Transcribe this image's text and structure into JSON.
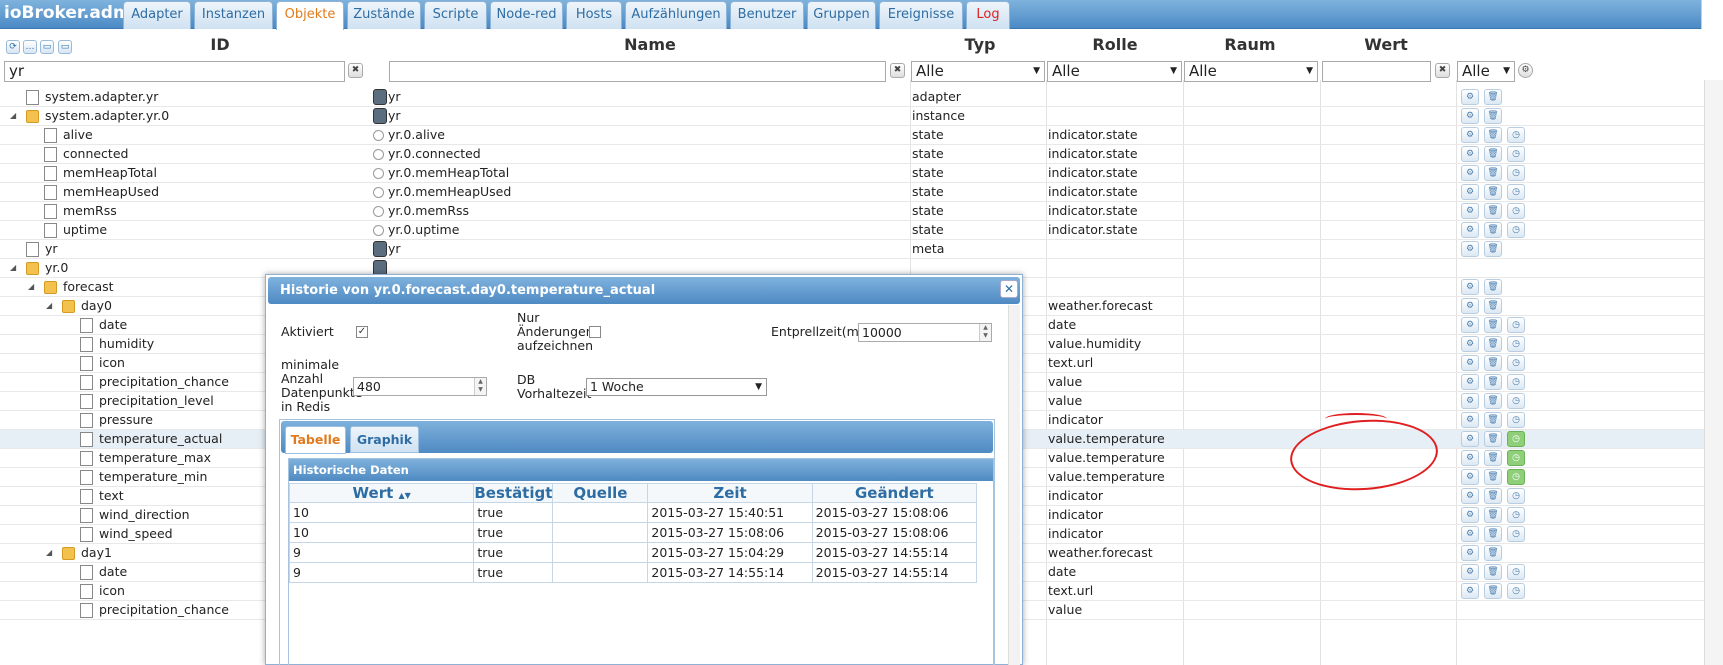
{
  "app": {
    "title": "ioBroker.admin"
  },
  "tabs": [
    {
      "label": "Adapter"
    },
    {
      "label": "Instanzen"
    },
    {
      "label": "Objekte"
    },
    {
      "label": "Zustände"
    },
    {
      "label": "Scripte"
    },
    {
      "label": "Node-red"
    },
    {
      "label": "Hosts"
    },
    {
      "label": "Aufzählungen"
    },
    {
      "label": "Benutzer"
    },
    {
      "label": "Gruppen"
    },
    {
      "label": "Ereignisse"
    },
    {
      "label": "Log"
    }
  ],
  "columns": {
    "id": "ID",
    "name": "Name",
    "typ": "Typ",
    "rolle": "Rolle",
    "raum": "Raum",
    "wert": "Wert"
  },
  "filters": {
    "id": "yr",
    "name": "",
    "typ": "Alle",
    "rolle": "Alle",
    "raum": "Alle",
    "wert": "",
    "extra": "Alle"
  },
  "rows": [
    {
      "id": "system.adapter.yr",
      "name": "yr",
      "typ": "adapter",
      "rolle": ""
    },
    {
      "id": "system.adapter.yr.0",
      "name": "yr",
      "typ": "instance",
      "rolle": ""
    },
    {
      "id": "alive",
      "name": "yr.0.alive",
      "typ": "state",
      "rolle": "indicator.state"
    },
    {
      "id": "connected",
      "name": "yr.0.connected",
      "typ": "state",
      "rolle": "indicator.state"
    },
    {
      "id": "memHeapTotal",
      "name": "yr.0.memHeapTotal",
      "typ": "state",
      "rolle": "indicator.state"
    },
    {
      "id": "memHeapUsed",
      "name": "yr.0.memHeapUsed",
      "typ": "state",
      "rolle": "indicator.state"
    },
    {
      "id": "memRss",
      "name": "yr.0.memRss",
      "typ": "state",
      "rolle": "indicator.state"
    },
    {
      "id": "uptime",
      "name": "yr.0.uptime",
      "typ": "state",
      "rolle": "indicator.state"
    },
    {
      "id": "yr",
      "name": "yr",
      "typ": "meta",
      "rolle": ""
    },
    {
      "id": "yr.0",
      "name": "",
      "typ": "",
      "rolle": ""
    },
    {
      "id": "forecast",
      "name": "",
      "typ": "",
      "rolle": ""
    },
    {
      "id": "day0",
      "name": "",
      "typ": "",
      "rolle": "weather.forecast"
    },
    {
      "id": "date",
      "name": "",
      "typ": "",
      "rolle": "date"
    },
    {
      "id": "humidity",
      "name": "",
      "typ": "",
      "rolle": "value.humidity"
    },
    {
      "id": "icon",
      "name": "",
      "typ": "",
      "rolle": "text.url"
    },
    {
      "id": "precipitation_chance",
      "name": "",
      "typ": "",
      "rolle": "value"
    },
    {
      "id": "precipitation_level",
      "name": "",
      "typ": "",
      "rolle": "value"
    },
    {
      "id": "pressure",
      "name": "",
      "typ": "",
      "rolle": "indicator"
    },
    {
      "id": "temperature_actual",
      "name": "",
      "typ": "",
      "rolle": "value.temperature"
    },
    {
      "id": "temperature_max",
      "name": "",
      "typ": "",
      "rolle": "value.temperature"
    },
    {
      "id": "temperature_min",
      "name": "",
      "typ": "",
      "rolle": "value.temperature"
    },
    {
      "id": "text",
      "name": "",
      "typ": "",
      "rolle": "indicator"
    },
    {
      "id": "wind_direction",
      "name": "",
      "typ": "",
      "rolle": "indicator"
    },
    {
      "id": "wind_speed",
      "name": "",
      "typ": "",
      "rolle": "indicator"
    },
    {
      "id": "day1",
      "name": "",
      "typ": "",
      "rolle": "weather.forecast"
    },
    {
      "id": "date",
      "name": "",
      "typ": "",
      "rolle": "date"
    },
    {
      "id": "icon",
      "name": "",
      "typ": "",
      "rolle": "text.url"
    },
    {
      "id": "precipitation_chance",
      "name": "",
      "typ": "",
      "rolle": "value"
    }
  ],
  "dialog": {
    "title": "Historie von yr.0.forecast.day0.temperature_actual",
    "aktiviert_label": "Aktiviert",
    "aktiviert_checked": "✓",
    "nur_label": "Nur Änderungen aufzeichnen",
    "entprell_label": "Entprellzeit(ms)",
    "entprell_value": "10000",
    "min_label": "minimale Anzahl Datenpunkte in Redis",
    "min_value": "480",
    "db_label": "DB Vorhaltezeit",
    "db_value": "1 Woche",
    "tab_tabelle": "Tabelle",
    "tab_graphik": "Graphik",
    "hist_title": "Historische Daten",
    "columns": [
      "Wert",
      "Bestätigt",
      "Quelle",
      "Zeit",
      "Geändert"
    ],
    "data": [
      [
        "10",
        "true",
        "",
        "2015-03-27 15:40:51",
        "2015-03-27 15:08:06"
      ],
      [
        "10",
        "true",
        "",
        "2015-03-27 15:08:06",
        "2015-03-27 15:08:06"
      ],
      [
        "9",
        "true",
        "",
        "2015-03-27 15:04:29",
        "2015-03-27 14:55:14"
      ],
      [
        "9",
        "true",
        "",
        "2015-03-27 14:55:14",
        "2015-03-27 14:55:14"
      ]
    ]
  },
  "icons": {
    "gear": "gear-icon",
    "trash": "trash-icon",
    "clock": "clock-icon",
    "folder": "folder-icon",
    "file": "file-icon"
  }
}
